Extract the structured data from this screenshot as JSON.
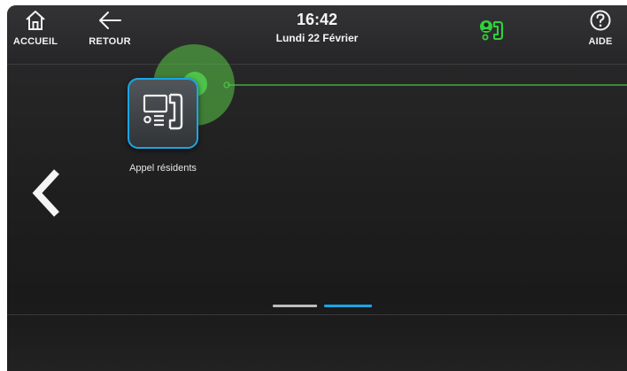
{
  "header": {
    "home_label": "ACCUEIL",
    "back_label": "RETOUR",
    "time": "16:42",
    "date": "Lundi 22 Février",
    "help_label": "AIDE"
  },
  "apps": [
    {
      "label": "Appel résidents",
      "icon": "intercom-handset-icon"
    }
  ],
  "pager": {
    "pages": 2,
    "active_page": 2
  },
  "colors": {
    "accent": "#1aa6e6",
    "status_green": "#2fd23a",
    "touch_glow": "#5ac846",
    "background": "#232324"
  }
}
